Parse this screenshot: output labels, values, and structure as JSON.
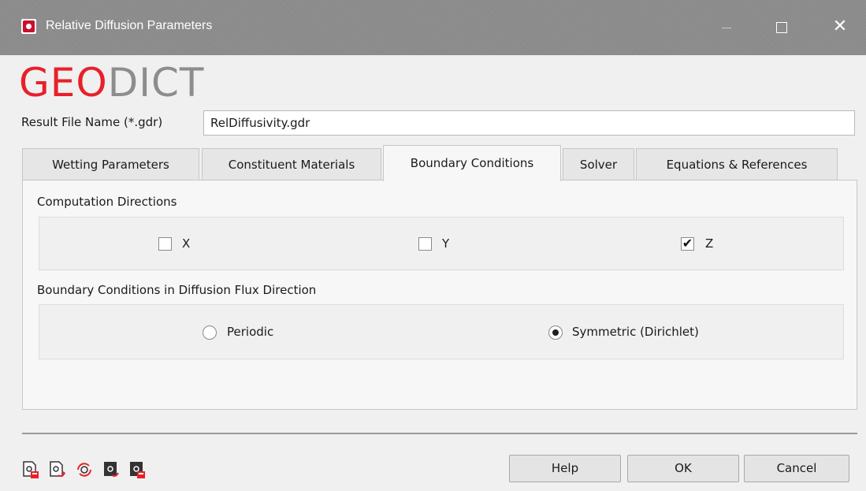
{
  "window": {
    "title": "Relative Diffusion Parameters",
    "close_glyph": "✕"
  },
  "logo": {
    "part1": "GeoDict",
    "geo": "GEO",
    "dict": "DICT"
  },
  "result_file": {
    "label": "Result File Name (*.gdr)",
    "value": "RelDiffusivity.gdr"
  },
  "tabs": [
    {
      "label": "Wetting Parameters"
    },
    {
      "label": "Constituent Materials"
    },
    {
      "label": "Boundary Conditions"
    },
    {
      "label": "Solver"
    },
    {
      "label": "Equations & References"
    }
  ],
  "active_tab": "Boundary Conditions",
  "computation_directions": {
    "title": "Computation Directions",
    "options": [
      {
        "label": "X",
        "checked": false,
        "mark": ""
      },
      {
        "label": "Y",
        "checked": false,
        "mark": ""
      },
      {
        "label": "Z",
        "checked": true,
        "mark": "✔"
      }
    ]
  },
  "boundary_conditions": {
    "title": "Boundary Conditions in Diffusion Flux Direction",
    "options": [
      {
        "label": "Periodic",
        "selected": false
      },
      {
        "label": "Symmetric (Dirichlet)",
        "selected": true
      }
    ]
  },
  "toolbar_icons": [
    "save-settings-icon",
    "load-settings-icon",
    "reset-settings-icon",
    "export-settings-icon",
    "delete-settings-icon"
  ],
  "buttons": {
    "help": "Help",
    "ok": "OK",
    "cancel": "Cancel"
  },
  "colors": {
    "brand_red": "#e8202a",
    "logo_gray": "#8d8d8d",
    "titlebar": "#8a8a8a"
  }
}
